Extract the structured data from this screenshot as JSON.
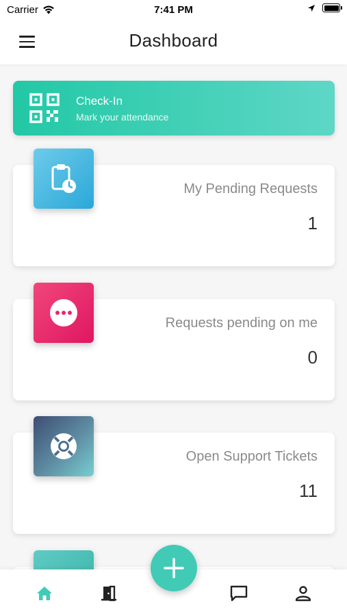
{
  "status_bar": {
    "carrier": "Carrier",
    "time": "7:41 PM"
  },
  "header": {
    "title": "Dashboard"
  },
  "checkin": {
    "title": "Check-In",
    "subtitle": "Mark your attendance",
    "icon": "qr-code-icon"
  },
  "cards": [
    {
      "label": "My Pending Requests",
      "value": "1",
      "icon": "clipboard-clock-icon",
      "color": "#2aa8d8"
    },
    {
      "label": "Requests pending on me",
      "value": "0",
      "icon": "more-dots-icon",
      "color": "#e01661"
    },
    {
      "label": "Open Support Tickets",
      "value": "11",
      "icon": "lifebuoy-icon",
      "color": "#3d4d74"
    }
  ],
  "bottom_nav": {
    "items": [
      {
        "name": "home",
        "icon": "home-icon",
        "active": true
      },
      {
        "name": "leave",
        "icon": "door-icon",
        "active": false
      },
      {
        "name": "messages",
        "icon": "chat-icon",
        "active": false
      },
      {
        "name": "profile",
        "icon": "user-icon",
        "active": false
      }
    ],
    "fab_icon": "plus-icon"
  },
  "colors": {
    "accent": "#41cbb6",
    "active_nav": "#41cbb6",
    "inactive_nav": "#222222"
  }
}
